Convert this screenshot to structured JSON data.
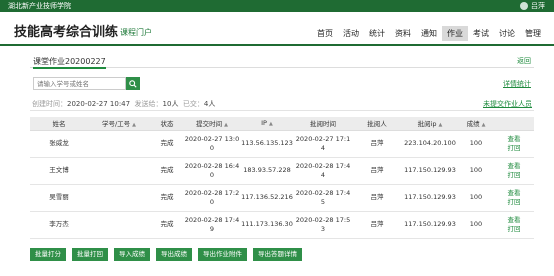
{
  "topbar": {
    "school": "湖北新产业技师学院",
    "user": "吕萍"
  },
  "header": {
    "title": "技能高考综合训练",
    "subtitle": "课程门户"
  },
  "nav": [
    "首页",
    "活动",
    "统计",
    "资料",
    "通知",
    "作业",
    "考试",
    "讨论",
    "管理"
  ],
  "nav_active": "作业",
  "section": {
    "name": "课堂作业20200227",
    "back": "返回"
  },
  "search": {
    "placeholder": "请输入学号或姓名",
    "stats_link": "详情统计"
  },
  "meta": {
    "created_label": "创建时间：",
    "created": "2020-02-27 10:47",
    "sent_label": "发送给：",
    "sent": "10人",
    "submitted_label": "已交：",
    "submitted": "4人",
    "unsubmitted_link": "未提交作业人员"
  },
  "table": {
    "headers": [
      "姓名",
      "学号/工号",
      "状态",
      "提交时间",
      "IP",
      "批阅时间",
      "批阅人",
      "批阅ip",
      "成绩"
    ],
    "rows": [
      {
        "name": "张威龙",
        "id": "",
        "status": "完成",
        "submit": "2020-02-27 13:00",
        "ip": "113.56.135.123",
        "review_time": "2020-02-27 17:14",
        "reviewer": "吕萍",
        "review_ip": "223.104.20.100",
        "score": "100"
      },
      {
        "name": "王文博",
        "id": "",
        "status": "完成",
        "submit": "2020-02-28 16:40",
        "ip": "183.93.57.228",
        "review_time": "2020-02-28 17:44",
        "reviewer": "吕萍",
        "review_ip": "117.150.129.93",
        "score": "100"
      },
      {
        "name": "吴雪丽",
        "id": "",
        "status": "完成",
        "submit": "2020-02-28 17:20",
        "ip": "117.136.52.216",
        "review_time": "2020-02-28 17:45",
        "reviewer": "吕萍",
        "review_ip": "117.150.129.93",
        "score": "100"
      },
      {
        "name": "李万杰",
        "id": "",
        "status": "完成",
        "submit": "2020-02-28 17:49",
        "ip": "111.173.136.30",
        "review_time": "2020-02-28 17:53",
        "reviewer": "吕萍",
        "review_ip": "117.150.129.93",
        "score": "100"
      }
    ],
    "view_label": "查看",
    "return_label": "打回"
  },
  "actions": [
    "批量打分",
    "批量打回",
    "导入成绩",
    "导出成绩",
    "导出作业附件",
    "导出答题详情"
  ],
  "colors": {
    "brand": "#1f6b33",
    "accent": "#2f8f48",
    "link": "#1f8b3e"
  }
}
